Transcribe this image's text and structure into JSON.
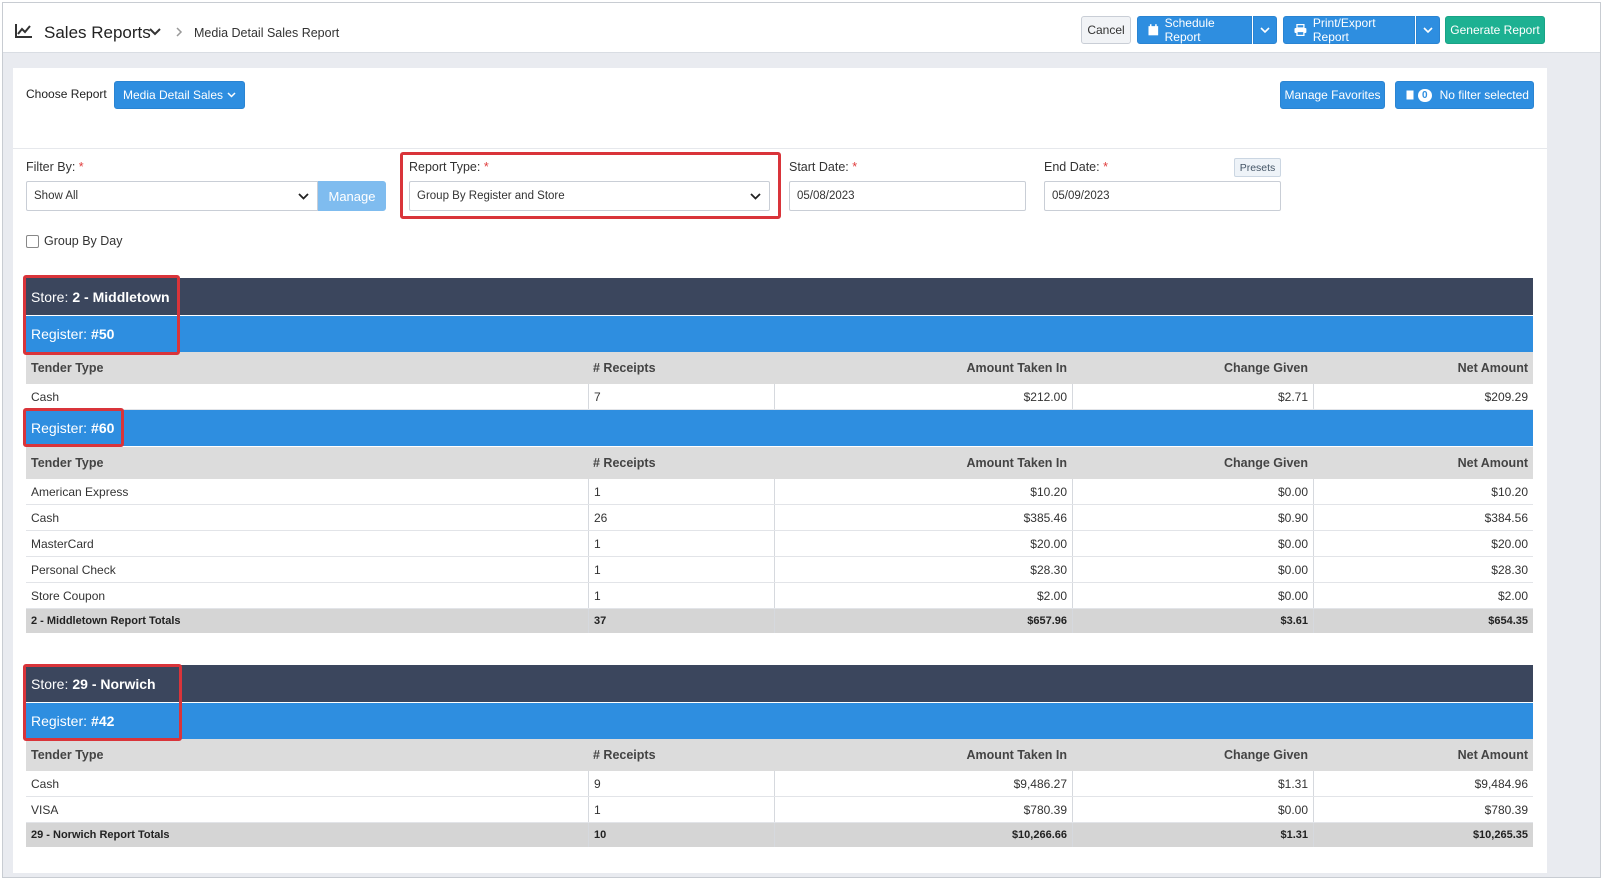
{
  "header": {
    "title": "Sales Reports",
    "breadcrumb": "Media Detail Sales Report",
    "cancel": "Cancel",
    "schedule": "Schedule Report",
    "print": "Print/Export Report",
    "generate": "Generate Report"
  },
  "toolbar": {
    "choose_label": "Choose Report",
    "report_button": "Media Detail Sales",
    "favorites": "Manage Favorites",
    "filter_count": "0",
    "filter_text": "No filter selected"
  },
  "filters": {
    "filter_by_label": "Filter By:",
    "filter_by_value": "Show All",
    "manage": "Manage",
    "report_type_label": "Report Type:",
    "report_type_value": "Group By Register and Store",
    "start_label": "Start Date:",
    "start_value": "05/08/2023",
    "end_label": "End Date:",
    "end_value": "05/09/2023",
    "presets": "Presets",
    "required_mark": "*",
    "group_by_day": "Group By Day"
  },
  "columns": [
    "Tender Type",
    "# Receipts",
    "Amount Taken In",
    "Change Given",
    "Net Amount"
  ],
  "labels": {
    "store": "Store:",
    "register": "Register:"
  },
  "stores": [
    {
      "name": "2 - Middletown",
      "registers": [
        {
          "name": "#50",
          "rows": [
            [
              "Cash",
              "7",
              "$212.00",
              "$2.71",
              "$209.29"
            ]
          ]
        },
        {
          "name": "#60",
          "rows": [
            [
              "American Express",
              "1",
              "$10.20",
              "$0.00",
              "$10.20"
            ],
            [
              "Cash",
              "26",
              "$385.46",
              "$0.90",
              "$384.56"
            ],
            [
              "MasterCard",
              "1",
              "$20.00",
              "$0.00",
              "$20.00"
            ],
            [
              "Personal Check",
              "1",
              "$28.30",
              "$0.00",
              "$28.30"
            ],
            [
              "Store Coupon",
              "1",
              "$2.00",
              "$0.00",
              "$2.00"
            ]
          ]
        }
      ],
      "totals": [
        "2 - Middletown Report Totals",
        "37",
        "$657.96",
        "$3.61",
        "$654.35"
      ]
    },
    {
      "name": "29 - Norwich",
      "registers": [
        {
          "name": "#42",
          "rows": [
            [
              "Cash",
              "9",
              "$9,486.27",
              "$1.31",
              "$9,484.96"
            ],
            [
              "VISA",
              "1",
              "$780.39",
              "$0.00",
              "$780.39"
            ]
          ]
        }
      ],
      "totals": [
        "29 - Norwich Report Totals",
        "10",
        "$10,266.66",
        "$1.31",
        "$10,265.35"
      ]
    }
  ],
  "colors": {
    "store_bar": "#3b465d",
    "register_bar": "#2e8ee0",
    "highlight": "#d9343a",
    "generate": "#1db192"
  }
}
